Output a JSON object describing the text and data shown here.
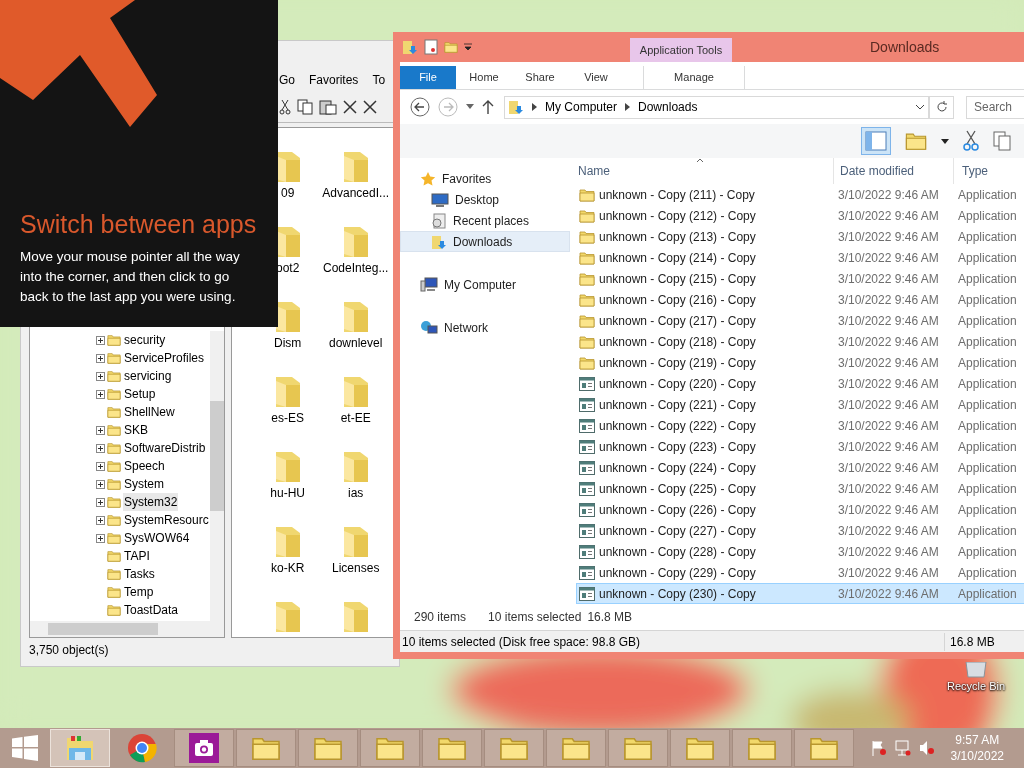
{
  "tip": {
    "title": "Switch between apps",
    "text": "Move your mouse pointer all the way into the corner, and then click to go back to the last app you were using."
  },
  "back_window": {
    "menu": [
      "Go",
      "Favorites",
      "To"
    ],
    "tree": [
      {
        "label": "security",
        "expandable": true,
        "selected": false
      },
      {
        "label": "ServiceProfiles",
        "expandable": true,
        "selected": false
      },
      {
        "label": "servicing",
        "expandable": true,
        "selected": false
      },
      {
        "label": "Setup",
        "expandable": true,
        "selected": false
      },
      {
        "label": "ShellNew",
        "expandable": false,
        "selected": false
      },
      {
        "label": "SKB",
        "expandable": true,
        "selected": false
      },
      {
        "label": "SoftwareDistrib",
        "expandable": true,
        "selected": false
      },
      {
        "label": "Speech",
        "expandable": true,
        "selected": false
      },
      {
        "label": "System",
        "expandable": true,
        "selected": false
      },
      {
        "label": "System32",
        "expandable": true,
        "selected": true
      },
      {
        "label": "SystemResourc",
        "expandable": true,
        "selected": false
      },
      {
        "label": "SysWOW64",
        "expandable": true,
        "selected": false
      },
      {
        "label": "TAPI",
        "expandable": false,
        "selected": false
      },
      {
        "label": "Tasks",
        "expandable": false,
        "selected": false
      },
      {
        "label": "Temp",
        "expandable": false,
        "selected": false
      },
      {
        "label": "ToastData",
        "expandable": false,
        "selected": false
      }
    ],
    "icons": [
      {
        "kind": "folder",
        "label": "09"
      },
      {
        "kind": "folder",
        "label": "AdvancedI..."
      },
      {
        "kind": "folder",
        "label": "oot2"
      },
      {
        "kind": "folder",
        "label": "CodeInteg..."
      },
      {
        "kind": "folder",
        "label": "Dism"
      },
      {
        "kind": "folder",
        "label": "downlevel"
      },
      {
        "kind": "folder",
        "label": "es-ES"
      },
      {
        "kind": "folder",
        "label": "et-EE"
      },
      {
        "kind": "folder",
        "label": "hu-HU"
      },
      {
        "kind": "folder",
        "label": "ias"
      },
      {
        "kind": "folder",
        "label": "ko-KR"
      },
      {
        "kind": "folder",
        "label": "Licenses"
      },
      {
        "kind": "folder"
      },
      {
        "kind": "folder"
      }
    ],
    "status": "3,750 object(s)"
  },
  "window": {
    "title": "Downloads",
    "context_tab": "Application Tools",
    "tabs": [
      {
        "label": "File",
        "selected": true
      },
      {
        "label": "Home",
        "selected": false
      },
      {
        "label": "Share",
        "selected": false
      },
      {
        "label": "View",
        "selected": false
      },
      {
        "label": "Manage",
        "selected": false
      }
    ],
    "path": [
      "My Computer",
      "Downloads"
    ],
    "search": {
      "placeholder": "Search"
    },
    "nav": [
      {
        "label": "Favorites",
        "kind": "favorites",
        "selected": false,
        "children": [
          {
            "label": "Desktop",
            "kind": "desktop",
            "selected": false
          },
          {
            "label": "Recent places",
            "kind": "recent",
            "selected": false
          },
          {
            "label": "Downloads",
            "kind": "downloads",
            "selected": true
          }
        ]
      },
      {
        "label": "My Computer",
        "kind": "computer",
        "selected": false
      },
      {
        "label": "Network",
        "kind": "network",
        "selected": false
      }
    ],
    "columns": [
      "Name",
      "Date modified",
      "Type"
    ],
    "rows": [
      {
        "name": "unknown - Copy (211) - Copy",
        "date": "3/10/2022 9:46 AM",
        "type": "Application",
        "kind": "folder",
        "selected": false
      },
      {
        "name": "unknown - Copy (212) - Copy",
        "date": "3/10/2022 9:46 AM",
        "type": "Application",
        "kind": "folder",
        "selected": false
      },
      {
        "name": "unknown - Copy (213) - Copy",
        "date": "3/10/2022 9:46 AM",
        "type": "Application",
        "kind": "folder",
        "selected": false
      },
      {
        "name": "unknown - Copy (214) - Copy",
        "date": "3/10/2022 9:46 AM",
        "type": "Application",
        "kind": "folder",
        "selected": false
      },
      {
        "name": "unknown - Copy (215) - Copy",
        "date": "3/10/2022 9:46 AM",
        "type": "Application",
        "kind": "folder",
        "selected": false
      },
      {
        "name": "unknown - Copy (216) - Copy",
        "date": "3/10/2022 9:46 AM",
        "type": "Application",
        "kind": "folder",
        "selected": false
      },
      {
        "name": "unknown - Copy (217) - Copy",
        "date": "3/10/2022 9:46 AM",
        "type": "Application",
        "kind": "folder",
        "selected": false
      },
      {
        "name": "unknown - Copy (218) - Copy",
        "date": "3/10/2022 9:46 AM",
        "type": "Application",
        "kind": "folder",
        "selected": false
      },
      {
        "name": "unknown - Copy (219) - Copy",
        "date": "3/10/2022 9:46 AM",
        "type": "Application",
        "kind": "folder",
        "selected": false
      },
      {
        "name": "unknown - Copy (220) - Copy",
        "date": "3/10/2022 9:46 AM",
        "type": "Application",
        "kind": "app",
        "selected": false
      },
      {
        "name": "unknown - Copy (221) - Copy",
        "date": "3/10/2022 9:46 AM",
        "type": "Application",
        "kind": "app",
        "selected": false
      },
      {
        "name": "unknown - Copy (222) - Copy",
        "date": "3/10/2022 9:46 AM",
        "type": "Application",
        "kind": "app",
        "selected": false
      },
      {
        "name": "unknown - Copy (223) - Copy",
        "date": "3/10/2022 9:46 AM",
        "type": "Application",
        "kind": "app",
        "selected": false
      },
      {
        "name": "unknown - Copy (224) - Copy",
        "date": "3/10/2022 9:46 AM",
        "type": "Application",
        "kind": "app",
        "selected": false
      },
      {
        "name": "unknown - Copy (225) - Copy",
        "date": "3/10/2022 9:46 AM",
        "type": "Application",
        "kind": "app",
        "selected": false
      },
      {
        "name": "unknown - Copy (226) - Copy",
        "date": "3/10/2022 9:46 AM",
        "type": "Application",
        "kind": "app",
        "selected": false
      },
      {
        "name": "unknown - Copy (227) - Copy",
        "date": "3/10/2022 9:46 AM",
        "type": "Application",
        "kind": "app",
        "selected": false
      },
      {
        "name": "unknown - Copy (228) - Copy",
        "date": "3/10/2022 9:46 AM",
        "type": "Application",
        "kind": "app",
        "selected": false
      },
      {
        "name": "unknown - Copy (229) - Copy",
        "date": "3/10/2022 9:46 AM",
        "type": "Application",
        "kind": "app",
        "selected": false
      },
      {
        "name": "unknown - Copy (230) - Copy",
        "date": "3/10/2022 9:46 AM",
        "type": "Application",
        "kind": "app",
        "selected": true
      }
    ],
    "status": {
      "count": "290 items",
      "selected": "10 items selected",
      "size": "16.8 MB"
    },
    "status_bar": {
      "text": "10 items selected (Disk free space: 98.8 GB)",
      "size": "16.8 MB"
    }
  },
  "desktop": {
    "recycle_bin": "Recycle Bin"
  },
  "taskbar": {
    "items": [
      {
        "kind": "start",
        "selected": false
      },
      {
        "kind": "explorer",
        "selected": true
      },
      {
        "kind": "chrome",
        "selected": false
      },
      {
        "kind": "camera",
        "selected": false
      },
      {
        "kind": "folder",
        "selected": false
      },
      {
        "kind": "folder",
        "selected": false
      },
      {
        "kind": "folder",
        "selected": false
      },
      {
        "kind": "folder",
        "selected": false
      },
      {
        "kind": "folder",
        "selected": false
      },
      {
        "kind": "folder",
        "selected": false
      },
      {
        "kind": "folder",
        "selected": false
      },
      {
        "kind": "folder",
        "selected": false
      },
      {
        "kind": "folder",
        "selected": false
      },
      {
        "kind": "folder",
        "selected": false
      }
    ],
    "time": "9:57 AM",
    "date": "3/10/2022"
  }
}
